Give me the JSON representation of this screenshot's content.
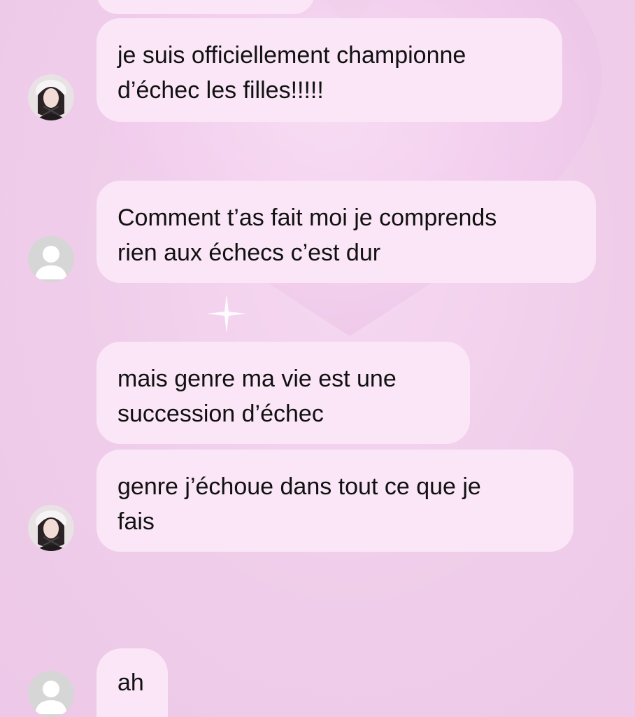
{
  "messages": [
    {
      "sender": "girl",
      "lines": [
        "je suis officiellement championne",
        "d’échec les filles!!!!!"
      ]
    },
    {
      "sender": "default",
      "lines": [
        "Comment t’as fait moi je comprends",
        "rien aux échecs c’est dur"
      ]
    },
    {
      "sender": "girl",
      "lines": [
        "mais genre ma vie est une",
        "succession d’échec"
      ]
    },
    {
      "sender": "girl",
      "lines": [
        "genre j’échoue dans tout ce que je",
        "fais"
      ]
    },
    {
      "sender": "default",
      "lines": [
        "ah"
      ]
    }
  ],
  "icons": {
    "girl_avatar": "profile-photo-icon",
    "default_avatar": "default-user-icon",
    "wallpaper": "heart-icon"
  },
  "colors": {
    "background": "#efcdea",
    "bubble": "#fae6f7",
    "text": "#111111",
    "default_avatar_bg": "#d6d6d6"
  }
}
